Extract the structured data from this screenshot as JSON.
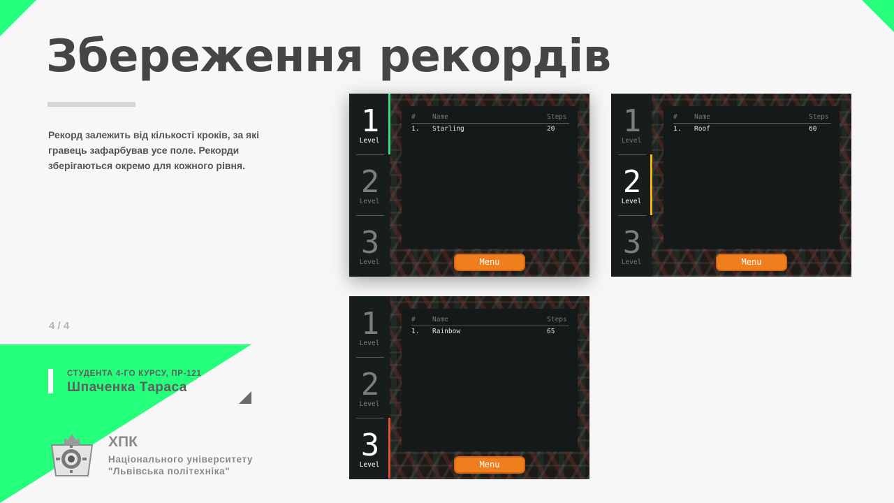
{
  "slide": {
    "title": "Збереження рекордів",
    "description": "Рекорд залежить від кількості кроків, за які гравець зафарбував усе поле. Рекорди зберігаються окремо для кожного рівня.",
    "page_number": "4 / 4",
    "author": {
      "role": "СТУДЕНТА 4-ГО КУРСУ, ПР-121",
      "name": "Шпаченка Тараса"
    },
    "org": {
      "short": "ХПК",
      "line1": "Національного університету",
      "line2": "\"Львівська політехніка\""
    },
    "colors": {
      "accent_green": "#24ff7c",
      "title": "#454545",
      "menu_button": "#ef7e1c"
    }
  },
  "screenshots": [
    {
      "active_level": 1,
      "accent_color": "#3ddc84",
      "levels": [
        {
          "num": "1",
          "label": "Level"
        },
        {
          "num": "2",
          "label": "Level"
        },
        {
          "num": "3",
          "label": "Level"
        }
      ],
      "table": {
        "headers": [
          "#",
          "Name",
          "Steps"
        ],
        "rows": [
          [
            "1.",
            "Starling",
            "20"
          ]
        ]
      },
      "menu_label": "Menu"
    },
    {
      "active_level": 2,
      "accent_color": "#f2b80f",
      "levels": [
        {
          "num": "1",
          "label": "Level"
        },
        {
          "num": "2",
          "label": "Level"
        },
        {
          "num": "3",
          "label": "Level"
        }
      ],
      "table": {
        "headers": [
          "#",
          "Name",
          "Steps"
        ],
        "rows": [
          [
            "1.",
            "Roof",
            "60"
          ]
        ]
      },
      "menu_label": "Menu"
    },
    {
      "active_level": 3,
      "accent_color": "#e0552e",
      "levels": [
        {
          "num": "1",
          "label": "Level"
        },
        {
          "num": "2",
          "label": "Level"
        },
        {
          "num": "3",
          "label": "Level"
        }
      ],
      "table": {
        "headers": [
          "#",
          "Name",
          "Steps"
        ],
        "rows": [
          [
            "1.",
            "Rainbow",
            "65"
          ]
        ]
      },
      "menu_label": "Menu"
    }
  ]
}
